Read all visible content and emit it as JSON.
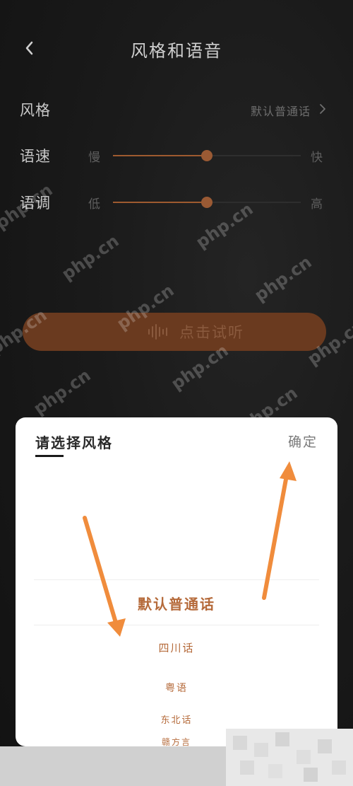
{
  "header": {
    "title": "风格和语音",
    "back_icon": "chevron-left-icon"
  },
  "settings": {
    "style": {
      "label": "风格",
      "value": "默认普通话",
      "icon": "chevron-right-icon"
    },
    "speed": {
      "label": "语速",
      "min_label": "慢",
      "max_label": "快",
      "level": 0.5
    },
    "tone": {
      "label": "语调",
      "min_label": "低",
      "max_label": "高",
      "level": 0.5
    }
  },
  "play_button": {
    "label": "点击试听",
    "icon": "sound-wave-icon"
  },
  "sheet": {
    "title": "请选择风格",
    "confirm_label": "确定",
    "options": [
      "默认普通话",
      "四川话",
      "粤语",
      "东北话",
      "赣方言"
    ],
    "selected_index": 0
  },
  "watermark": "php.cn",
  "colors": {
    "accent": "#9a5a34",
    "play_button": "#6a3a1f",
    "option_text": "#b56a3a",
    "annotation_arrow": "#f08c3c"
  }
}
